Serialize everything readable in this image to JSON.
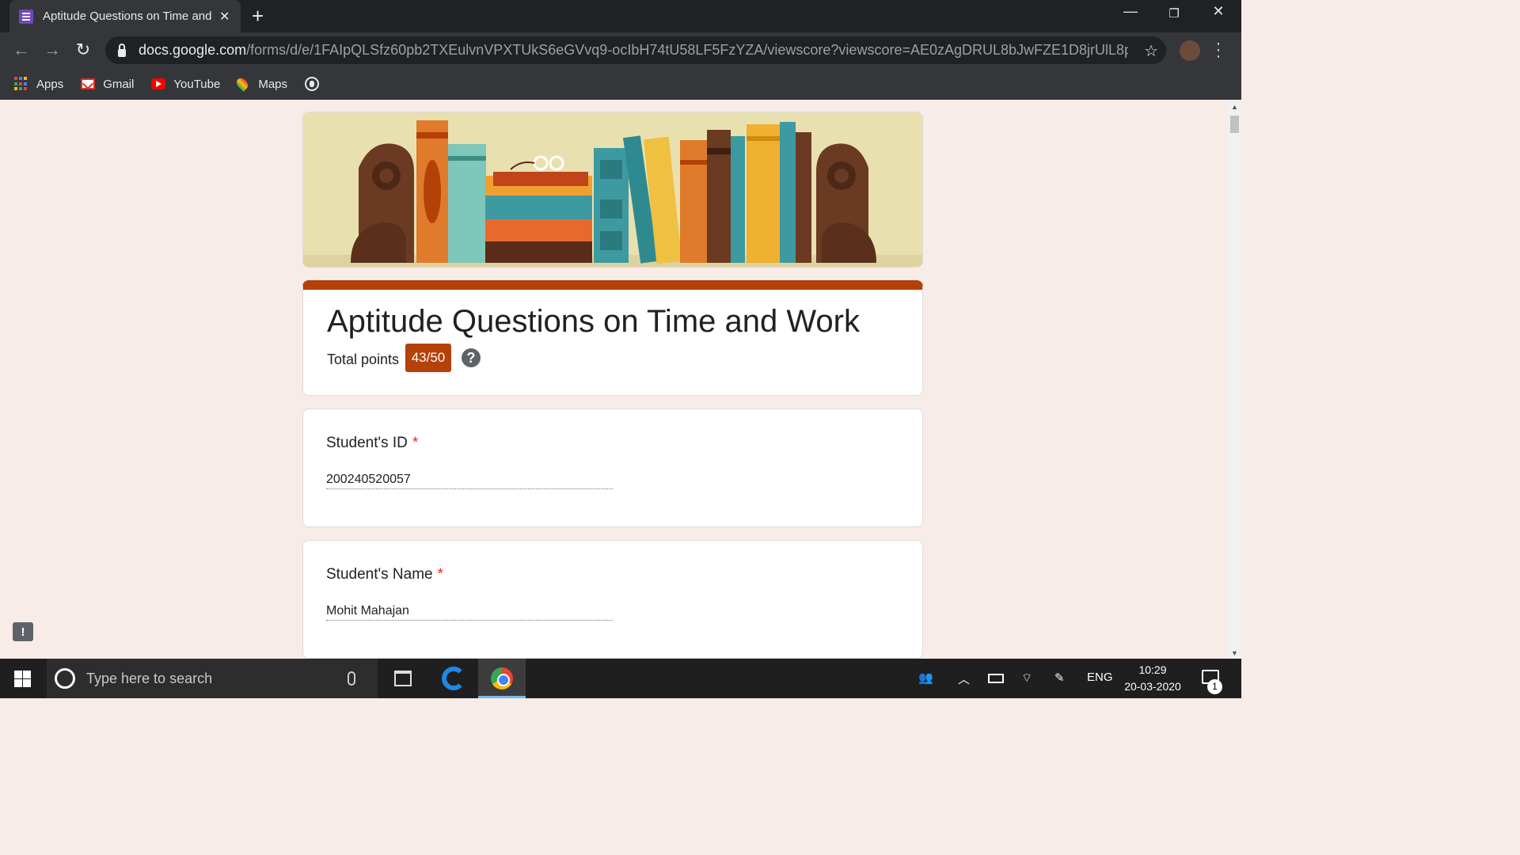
{
  "browser": {
    "tab_title": "Aptitude Questions on Time and Work",
    "url_host": "docs.google.com",
    "url_path": "/forms/d/e/1FAIpQLSfz60pb2TXEulvnVPXTUkS6eGVvq9-ocIbH74tU58LF5FzYZA/viewscore?viewscore=AE0zAgDRUL8bJwFZE1D8jrUlL8pde7c8Qvwl...",
    "bookmarks": [
      {
        "label": "Apps",
        "icon": "apps-icon"
      },
      {
        "label": "Gmail",
        "icon": "gmail-icon"
      },
      {
        "label": "YouTube",
        "icon": "youtube-icon"
      },
      {
        "label": "Maps",
        "icon": "maps-icon"
      }
    ]
  },
  "form": {
    "title": "Aptitude Questions on Time and Work",
    "total_points_label": "Total points",
    "score": "43/50",
    "help_symbol": "?",
    "accent_color": "#b44107",
    "questions": [
      {
        "label": "Student's ID",
        "required_mark": "*",
        "answer": "200240520057"
      },
      {
        "label": "Student's Name",
        "required_mark": "*",
        "answer": "Mohit Mahajan"
      }
    ]
  },
  "feedback_symbol": "!",
  "taskbar": {
    "search_placeholder": "Type here to search",
    "language": "ENG",
    "time": "10:29",
    "date": "20-03-2020",
    "notification_count": "1"
  }
}
